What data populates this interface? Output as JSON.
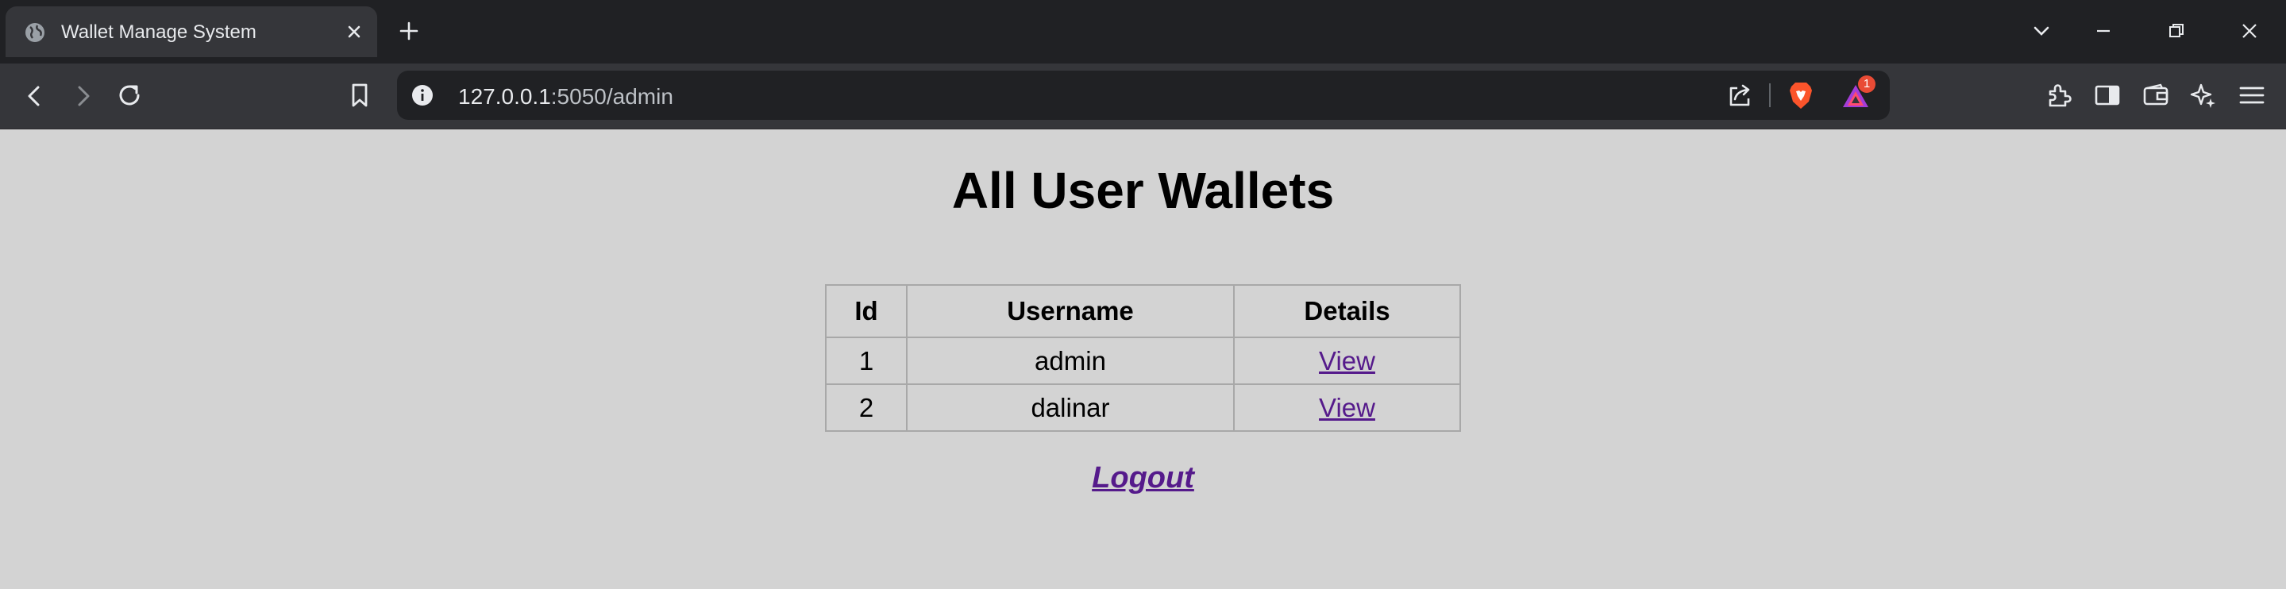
{
  "browser": {
    "tab": {
      "title": "Wallet Manage System",
      "favicon": "globe-icon"
    },
    "url_host": "127.0.0.1",
    "url_rest": ":5050/admin",
    "rewards_badge": "1"
  },
  "page": {
    "heading": "All User Wallets",
    "table": {
      "headers": [
        "Id",
        "Username",
        "Details"
      ],
      "rows": [
        {
          "id": "1",
          "username": "admin",
          "details": "View"
        },
        {
          "id": "2",
          "username": "dalinar",
          "details": "View"
        }
      ]
    },
    "logout_label": "Logout",
    "link_color": "#551a8b",
    "background": "#d3d3d3"
  }
}
